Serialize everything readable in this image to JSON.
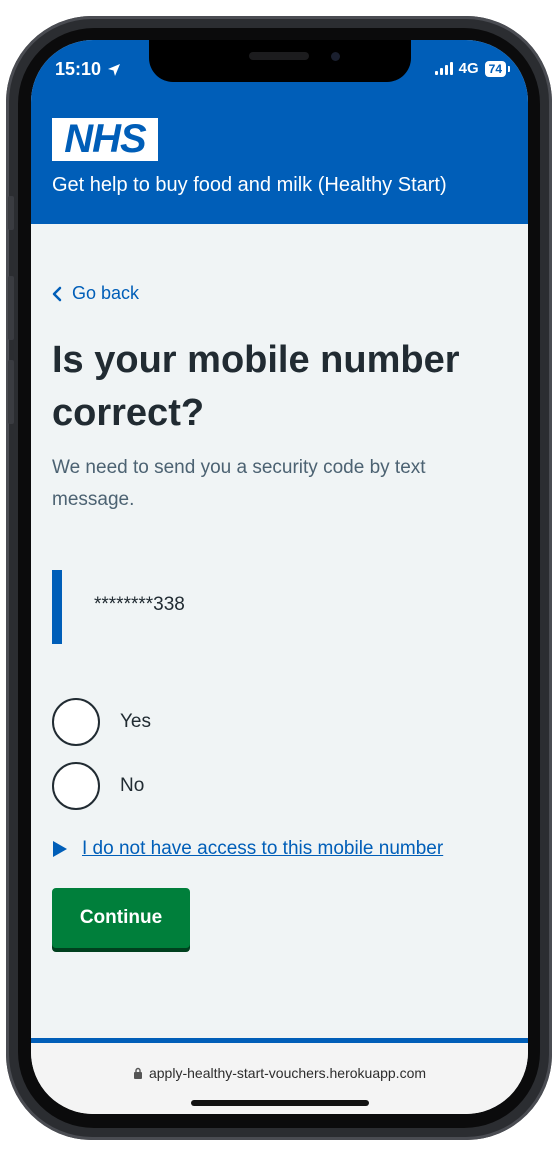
{
  "status_bar": {
    "time": "15:10",
    "network": "4G",
    "battery": "74"
  },
  "header": {
    "logo_text": "NHS",
    "service_name": "Get help to buy food and milk (Healthy Start)"
  },
  "back_link": "Go back",
  "heading": "Is your mobile number correct?",
  "hint": "We need to send you a security code by text message.",
  "mobile_number": "********338",
  "radio_options": [
    {
      "label": "Yes"
    },
    {
      "label": "No"
    }
  ],
  "details_summary": "I do not have access to this mobile number",
  "continue_button": "Continue",
  "url": "apply-healthy-start-vouchers.herokuapp.com",
  "colors": {
    "nhs_blue": "#005eb8",
    "button_green": "#007f3b",
    "background": "#f0f4f5"
  }
}
